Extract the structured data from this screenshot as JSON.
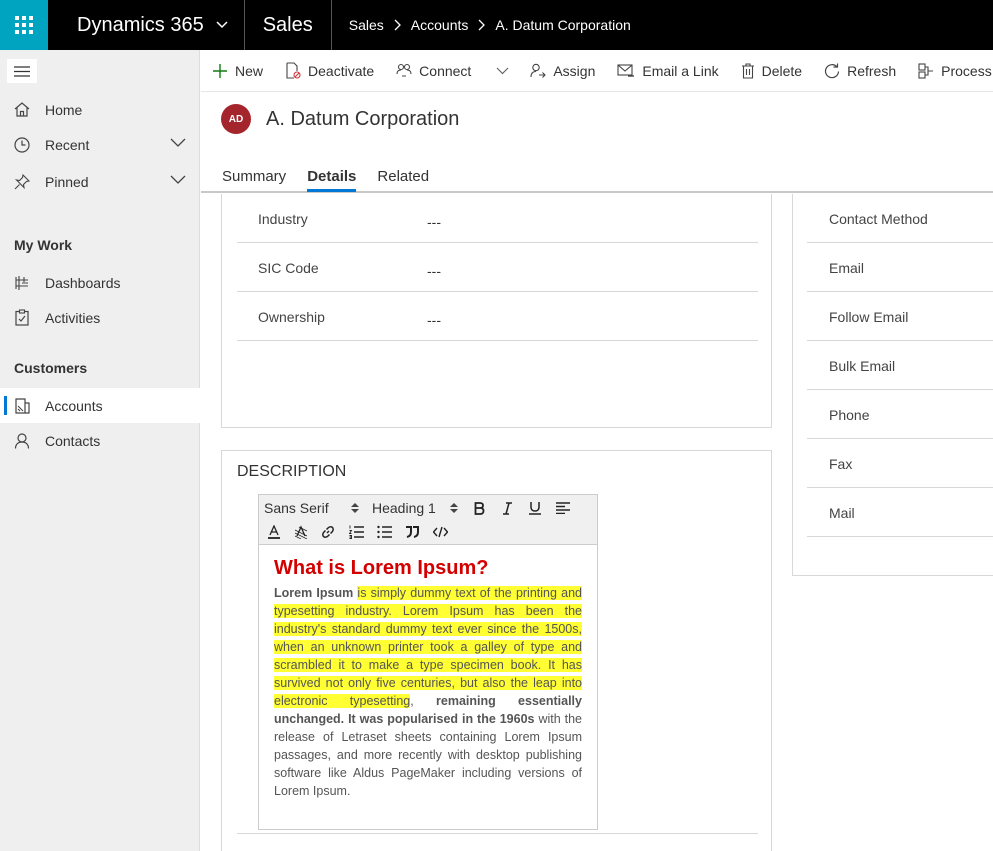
{
  "topbar": {
    "product": "Dynamics 365",
    "app": "Sales",
    "breadcrumbs": [
      "Sales",
      "Accounts",
      "A. Datum Corporation"
    ]
  },
  "sidebar": {
    "items": [
      {
        "label": "Home",
        "icon": "home-icon"
      },
      {
        "label": "Recent",
        "icon": "clock-icon"
      },
      {
        "label": "Pinned",
        "icon": "pin-icon"
      }
    ],
    "sections": [
      {
        "title": "My Work",
        "items": [
          {
            "label": "Dashboards",
            "icon": "dashboard-icon"
          },
          {
            "label": "Activities",
            "icon": "clipboard-icon"
          }
        ]
      },
      {
        "title": "Customers",
        "items": [
          {
            "label": "Accounts",
            "icon": "account-icon",
            "active": true
          },
          {
            "label": "Contacts",
            "icon": "person-icon"
          }
        ]
      }
    ]
  },
  "commands": [
    {
      "label": "New",
      "icon": "plus-icon"
    },
    {
      "label": "Deactivate",
      "icon": "deactivate-icon"
    },
    {
      "label": "Connect",
      "icon": "connect-icon"
    },
    {
      "label": "Assign",
      "icon": "assign-icon"
    },
    {
      "label": "Email a Link",
      "icon": "email-link-icon"
    },
    {
      "label": "Delete",
      "icon": "trash-icon"
    },
    {
      "label": "Refresh",
      "icon": "refresh-icon"
    },
    {
      "label": "Process",
      "icon": "process-icon"
    }
  ],
  "record": {
    "initials": "AD",
    "name": "A. Datum Corporation",
    "avatar_color": "#a4262c"
  },
  "tabs": [
    "Summary",
    "Details",
    "Related"
  ],
  "active_tab": "Details",
  "fields": [
    {
      "label": "Industry",
      "value": "---"
    },
    {
      "label": "SIC Code",
      "value": "---"
    },
    {
      "label": "Ownership",
      "value": "---"
    }
  ],
  "contact_prefs": [
    "Contact Method",
    "Email",
    "Follow Email",
    "Bulk Email",
    "Phone",
    "Fax",
    "Mail"
  ],
  "description": {
    "title": "DESCRIPTION",
    "font_picker": "Sans Serif",
    "heading_picker": "Heading 1",
    "heading": "What is Lorem Ipsum?",
    "p_bold_start": "Lorem Ipsum",
    "p_highlight": "is simply dummy text of the printing and typesetting industry. Lorem Ipsum has been the industry's standard dummy text ever since the 1500s, when an unknown printer took a galley of type and scrambled it to make a type specimen book. It has survived not only five centuries, but also the leap into electronic typesetting",
    "p_comma": ",",
    "p_bold_mid": "remaining essentially unchanged. It was popularised in the 1960s",
    "p_rest": "with the release of Letraset sheets containing Lorem Ipsum passages, and more recently with desktop publishing software like Aldus PageMaker including versions of Lorem Ipsum."
  },
  "colors": {
    "accent": "#0078d4",
    "waffle_bg": "#00a4c0",
    "heading_red": "#d40000",
    "highlight": "#ffff33"
  }
}
